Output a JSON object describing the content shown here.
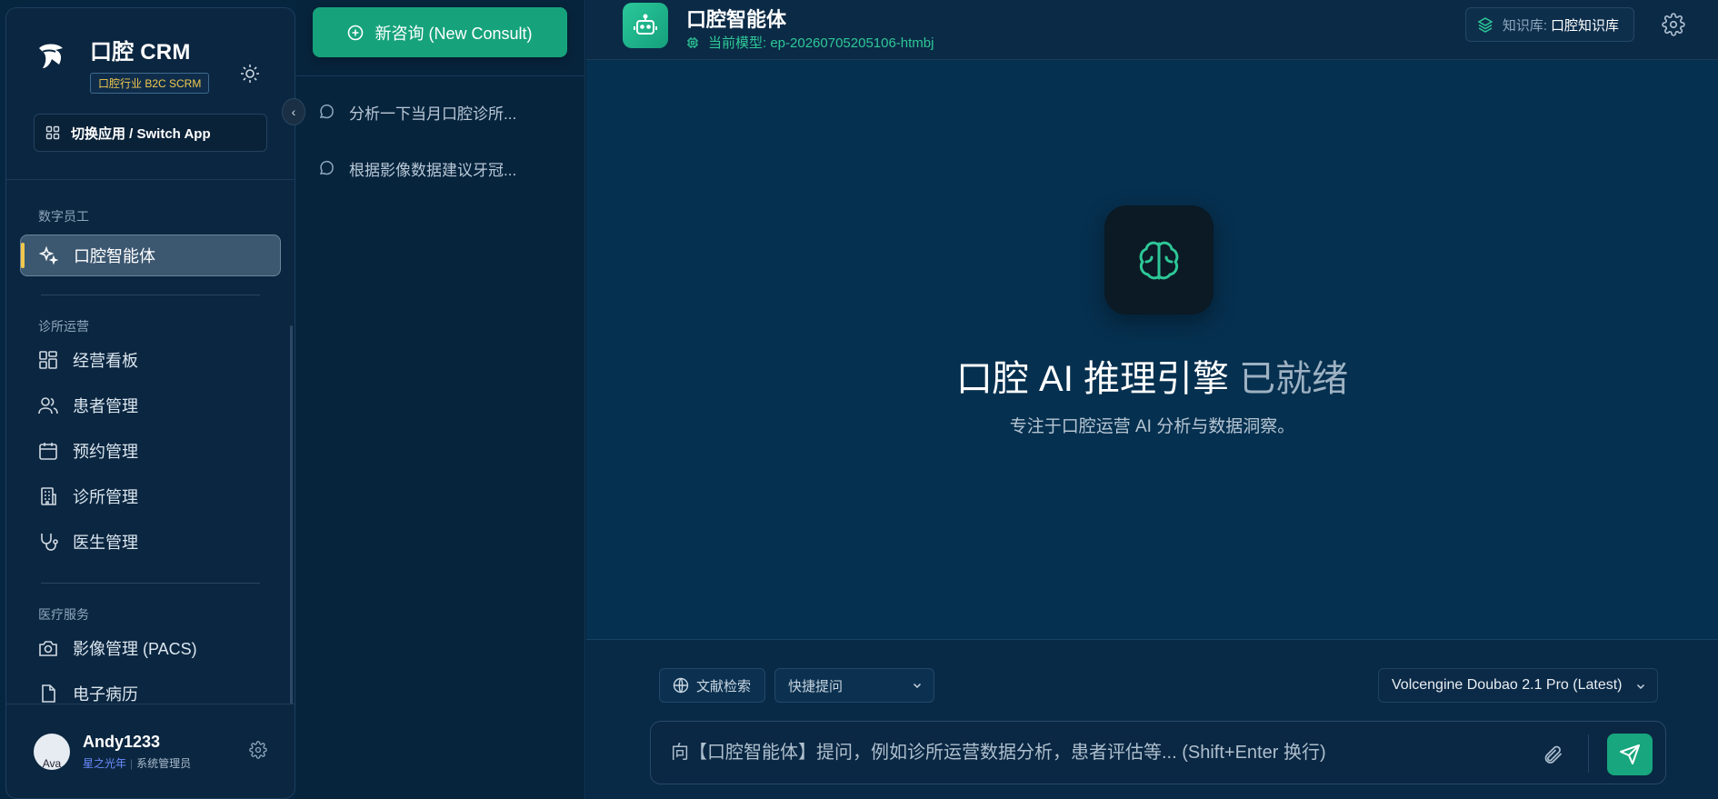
{
  "sidebar": {
    "brand_title": "口腔 CRM",
    "brand_badge": "口腔行业 B2C SCRM",
    "switch_app": "切换应用 / Switch App",
    "sections": {
      "digital_staff": "数字员工",
      "clinic_ops": "诊所运营",
      "medical": "医疗服务"
    },
    "items": {
      "agent": "口腔智能体",
      "dashboard": "经营看板",
      "patients": "患者管理",
      "appointments": "预约管理",
      "clinics": "诊所管理",
      "doctors": "医生管理",
      "pacs": "影像管理 (PACS)",
      "emr": "电子病历"
    },
    "collapse_glyph": "‹",
    "user": {
      "name": "Andy1233",
      "avatar_text": "Ava",
      "org": "星之光年",
      "separator": "|",
      "role": "系统管理员"
    }
  },
  "history": {
    "new_consult": "新咨询 (New Consult)",
    "items": [
      "分析一下当月口腔诊所...",
      "根据影像数据建议牙冠..."
    ]
  },
  "main": {
    "agent_title": "口腔智能体",
    "model_label": "当前模型: ep-20260705205106-htmbj",
    "kb_key": "知识库:",
    "kb_value": "口腔知识库",
    "hero_title_main": "口腔 AI 推理引擎",
    "hero_title_dim": "已就绪",
    "hero_subtitle": "专注于口腔运营 AI 分析与数据洞察。",
    "literature_search": "文献检索",
    "quick_ask": "快捷提问",
    "model_select": "Volcengine Doubao 2.1 Pro (Latest)",
    "input_placeholder": "向【口腔智能体】提问，例如诊所运营数据分析，患者评估等... (Shift+Enter 换行)"
  },
  "colors": {
    "accent": "#16a37c",
    "highlight": "#f2c94c",
    "background": "#062640"
  }
}
